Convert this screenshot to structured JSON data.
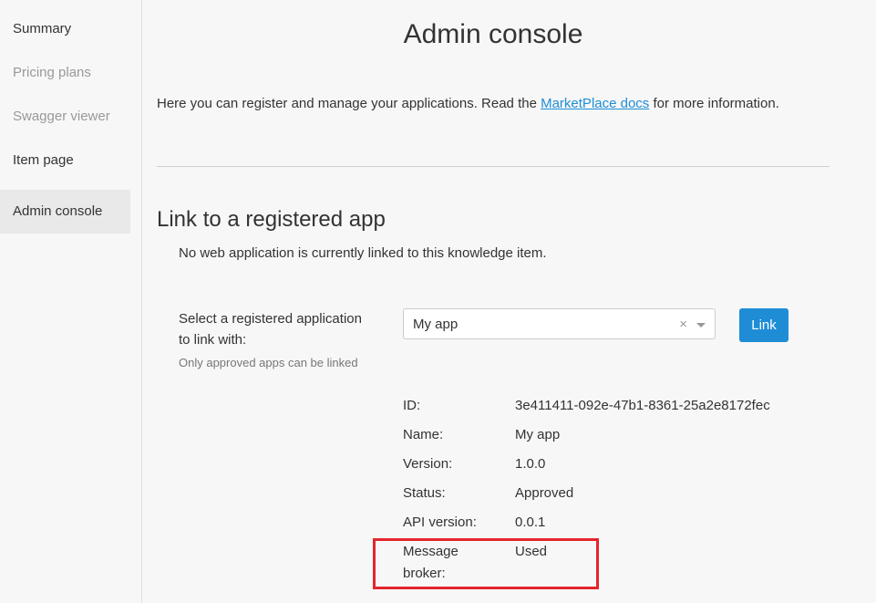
{
  "sidebar": {
    "items": [
      {
        "label": "Summary",
        "state": "enabled"
      },
      {
        "label": "Pricing plans",
        "state": "disabled"
      },
      {
        "label": "Swagger viewer",
        "state": "disabled"
      },
      {
        "label": "Item page",
        "state": "enabled"
      },
      {
        "label": "Admin console",
        "state": "active"
      }
    ]
  },
  "main": {
    "title": "Admin console",
    "intro_before": "Here you can register and manage your applications. Read the ",
    "intro_link": "MarketPlace docs",
    "intro_after": " for more information.",
    "section_title": "Link to a registered app",
    "no_link_text": "No web application is currently linked to this knowledge item.",
    "select_label_line1": "Select a registered application",
    "select_label_line2": "to link with:",
    "select_hint": "Only approved apps can be linked",
    "select_value": "My app",
    "select_clear": "×",
    "link_button": "Link",
    "details": [
      {
        "label": "ID:",
        "value": "3e411411-092e-47b1-8361-25a2e8172fec"
      },
      {
        "label": "Name:",
        "value": "My app"
      },
      {
        "label": "Version:",
        "value": "1.0.0"
      },
      {
        "label": "Status:",
        "value": "Approved"
      },
      {
        "label": "API version:",
        "value": "0.0.1"
      }
    ],
    "message_broker_label_line1": "Message",
    "message_broker_label_line2": "broker:",
    "message_broker_value": "Used"
  },
  "colors": {
    "accent": "#1f8dd6",
    "highlight": "#e3262e",
    "sidebar_active": "#e9e9e9"
  }
}
